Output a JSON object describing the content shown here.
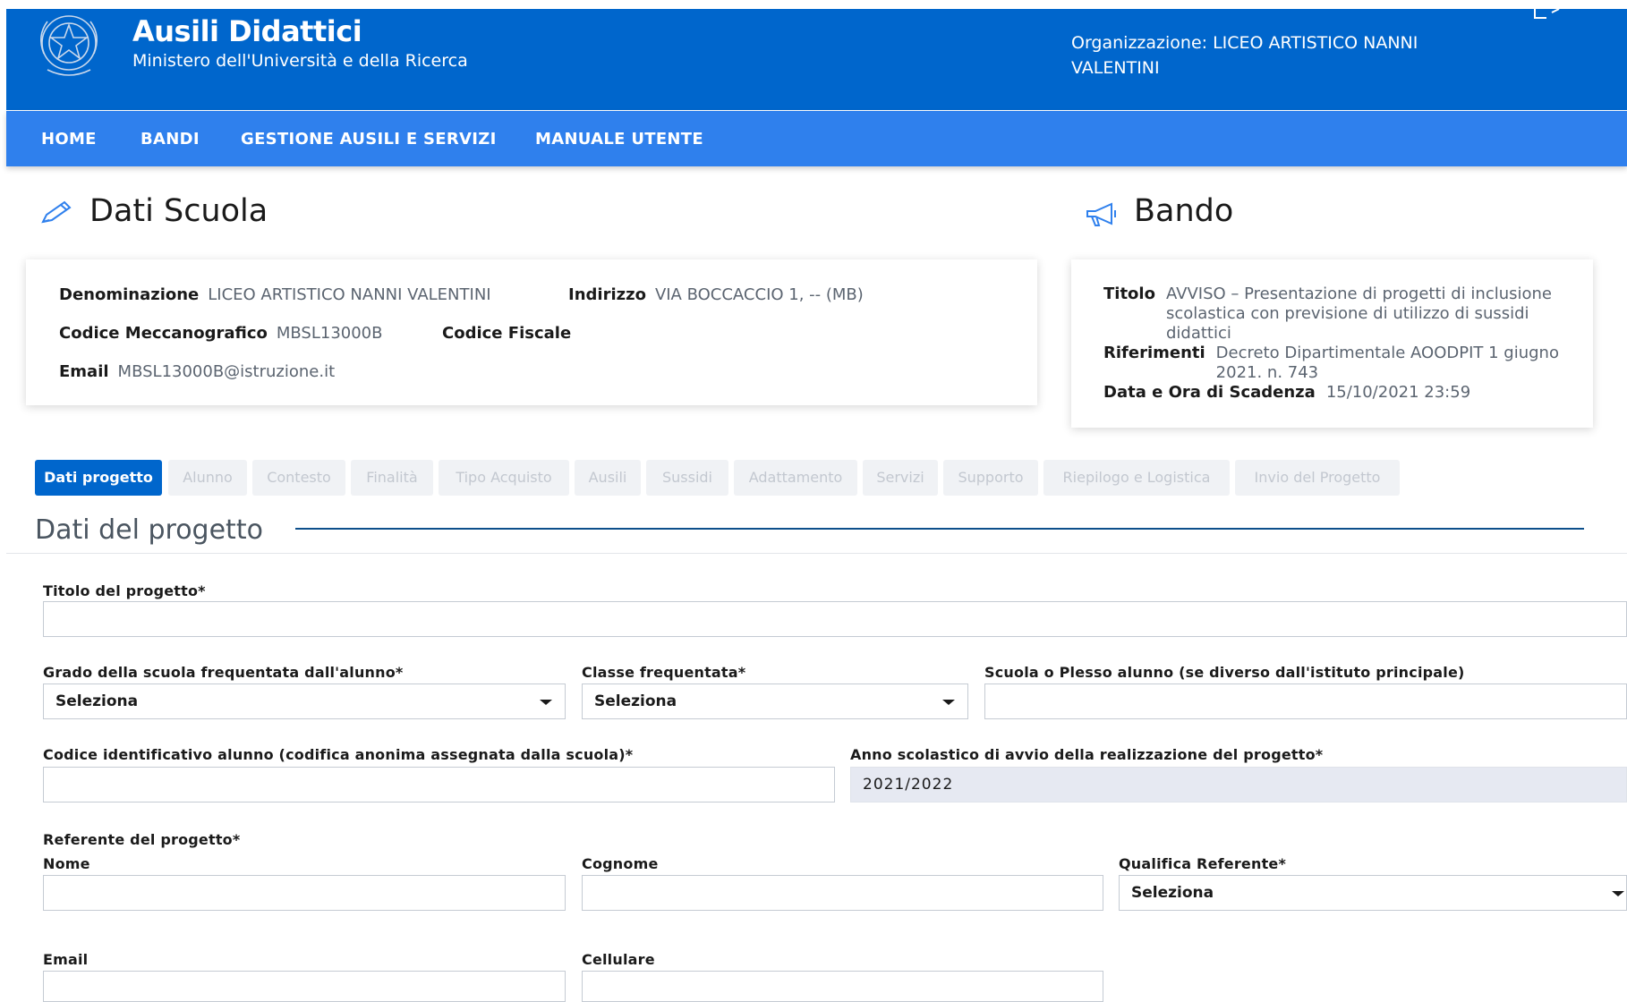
{
  "header": {
    "title": "Ausili Didattici",
    "subtitle": "Ministero dell'Università e della Ricerca",
    "organization": "Organizzazione: LICEO ARTISTICO NANNI VALENTINI",
    "icons": {
      "emblem": "republic-emblem-icon",
      "exit": "logout-icon"
    }
  },
  "nav": {
    "items": [
      "HOME",
      "BANDI",
      "GESTIONE AUSILI E SERVIZI",
      "MANUALE UTENTE"
    ]
  },
  "scuola": {
    "section_title": "Dati Scuola",
    "icon": "pencil-icon",
    "denominazione_label": "Denominazione",
    "denominazione_value": "LICEO ARTISTICO NANNI VALENTINI",
    "indirizzo_label": "Indirizzo",
    "indirizzo_value": "VIA BOCCACCIO 1, -- (MB)",
    "codice_mecc_label": "Codice Meccanografico",
    "codice_mecc_value": "MBSL13000B",
    "codice_fiscale_label": "Codice Fiscale",
    "email_label": "Email",
    "email_value": "MBSL13000B@istruzione.it"
  },
  "bando": {
    "section_title": "Bando",
    "icon": "megaphone-icon",
    "titolo_label": "Titolo",
    "titolo_value": "AVVISO – Presentazione di progetti di inclusione scolastica con previsione di utilizzo di sussidi didattici",
    "riferimenti_label": "Riferimenti",
    "riferimenti_value": "Decreto Dipartimentale AOODPIT 1 giugno 2021. n. 743",
    "scadenza_label": "Data e Ora di Scadenza",
    "scadenza_value": "15/10/2021 23:59"
  },
  "tabs": [
    "Dati progetto",
    "Alunno",
    "Contesto",
    "Finalità",
    "Tipo Acquisto",
    "Ausili",
    "Sussidi",
    "Adattamento",
    "Servizi",
    "Supporto",
    "Riepilogo e Logistica",
    "Invio del Progetto"
  ],
  "form": {
    "legend": "Dati del progetto",
    "titolo_label": "Titolo del progetto*",
    "titolo_value": "",
    "grado_label": "Grado della scuola frequentata dall'alunno*",
    "grado_value": "Seleziona",
    "classe_label": "Classe frequentata*",
    "classe_value": "Seleziona",
    "plesso_label": "Scuola o Plesso alunno (se diverso dall'istituto principale)",
    "plesso_value": "",
    "codice_alunno_label": "Codice identificativo alunno (codifica anonima assegnata dalla scuola)*",
    "codice_alunno_value": "",
    "anno_label": "Anno scolastico di avvio della realizzazione del progetto*",
    "anno_value": "2021/2022",
    "referente_label": "Referente del progetto*",
    "nome_label": "Nome",
    "nome_value": "",
    "cognome_label": "Cognome",
    "cognome_value": "",
    "qualifica_label": "Qualifica Referente*",
    "qualifica_value": "Seleziona",
    "email_label": "Email",
    "email_value": "",
    "cellulare_label": "Cellulare",
    "cellulare_value": ""
  },
  "colors": {
    "header": "#0066cc",
    "nav": "#2f80ed",
    "active_tab": "#0066cc",
    "legend_line": "#0d4f8b"
  }
}
